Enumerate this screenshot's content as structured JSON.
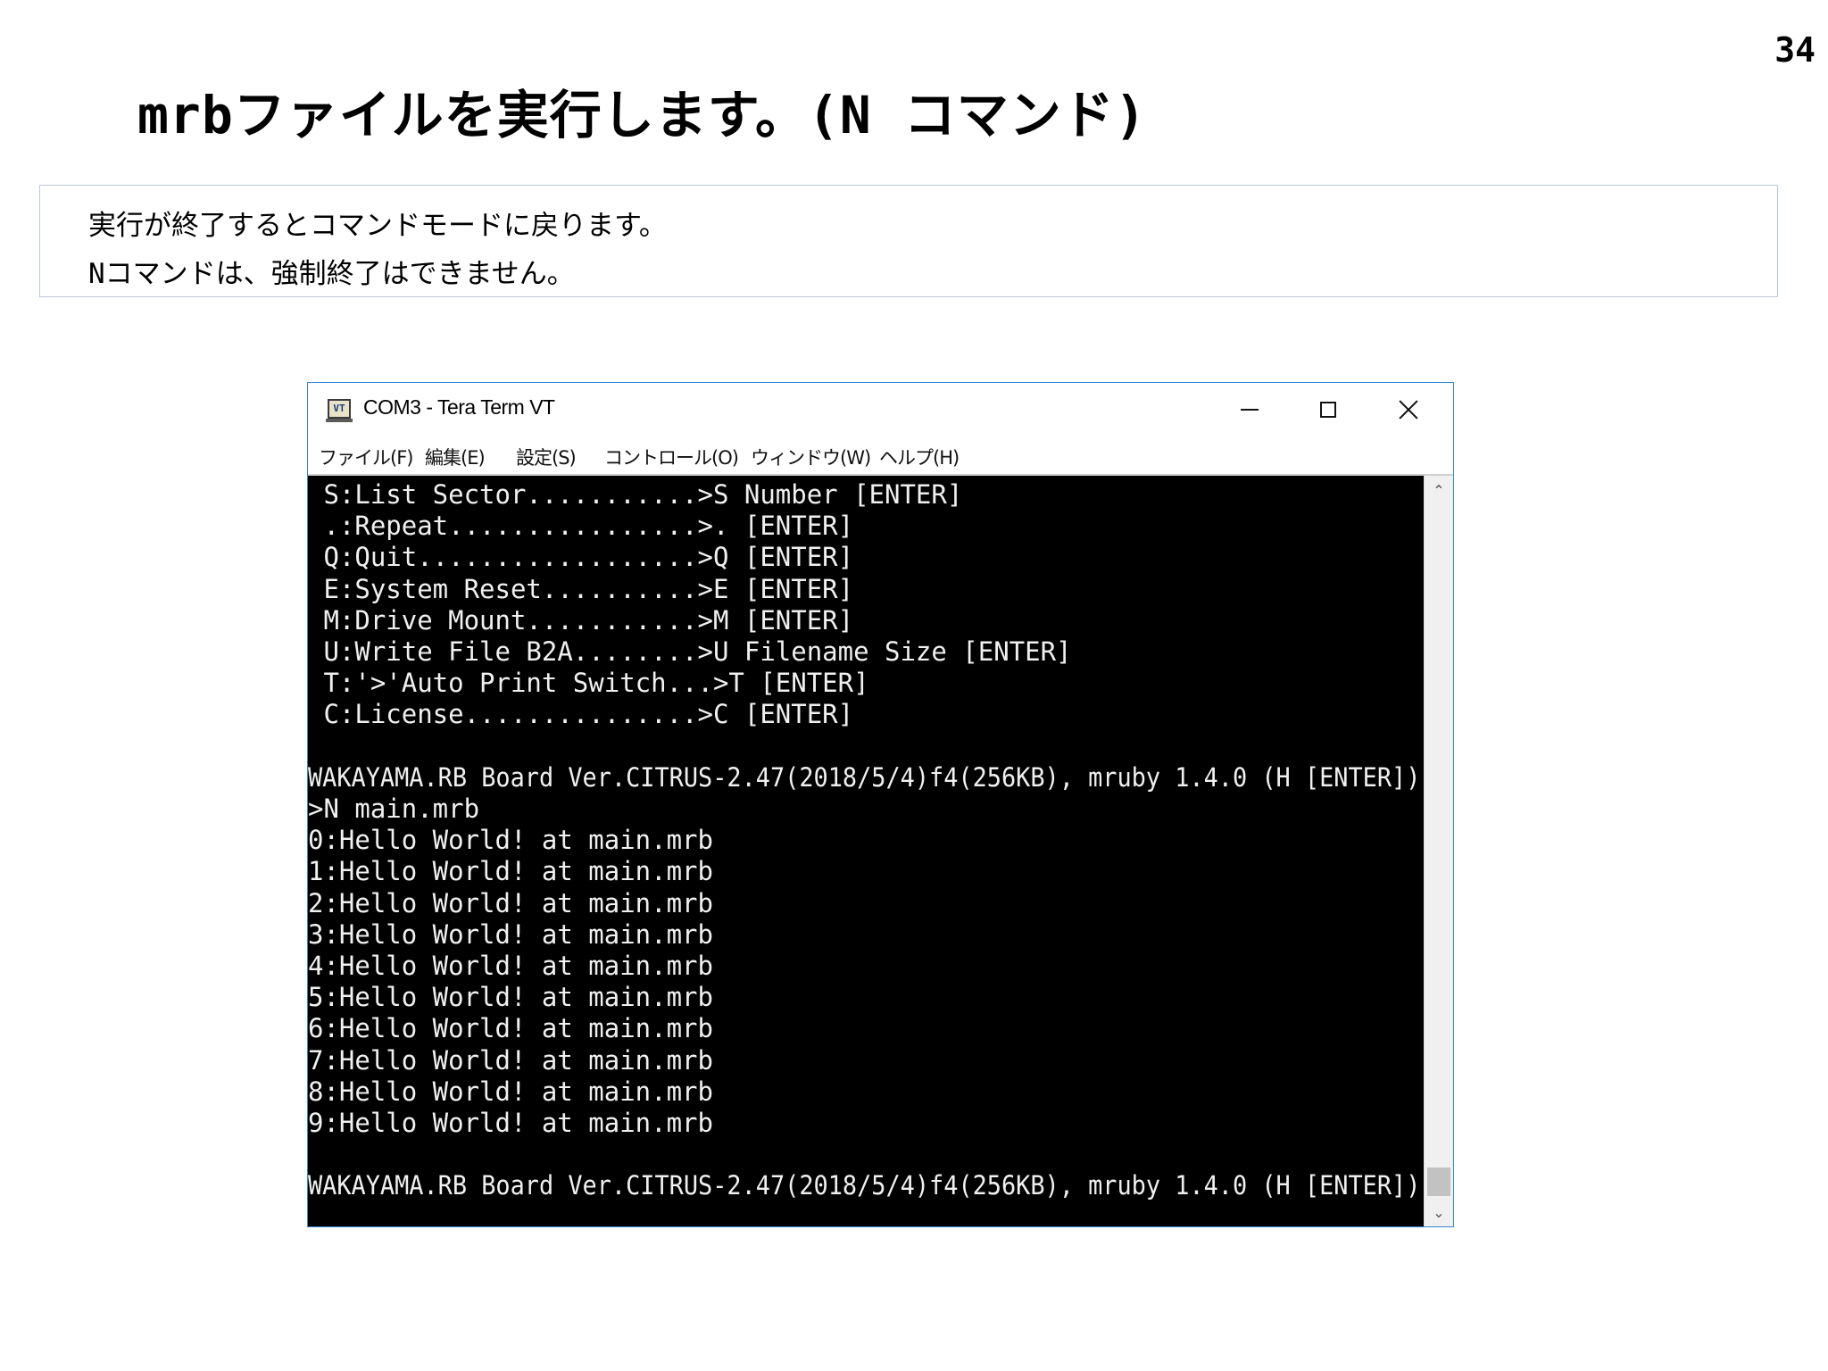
{
  "page": {
    "number": "34",
    "title": "mrbファイルを実行します。(N コマンド)",
    "notes": [
      "実行が終了するとコマンドモードに戻ります。",
      "Nコマンドは、強制終了はできません。"
    ]
  },
  "window": {
    "icon_label": "VT",
    "title": "COM3 - Tera Term VT",
    "menu": [
      "ファイル(F)",
      "編集(E)",
      "設定(S)",
      "コントロール(O)",
      "ウィンドウ(W)",
      "ヘルプ(H)"
    ]
  },
  "terminal": {
    "lines": [
      " S:List Sector...........>S Number [ENTER]",
      " .:Repeat................>. [ENTER]",
      " Q:Quit..................>Q [ENTER]",
      " E:System Reset..........>E [ENTER]",
      " M:Drive Mount...........>M [ENTER]",
      " U:Write File B2A........>U Filename Size [ENTER]",
      " T:'>'Auto Print Switch...>T [ENTER]",
      " C:License...............>C [ENTER]",
      "",
      "WAKAYAMA.RB Board Ver.CITRUS-2.47(2018/5/4)f4(256KB), mruby 1.4.0 (H [ENTER])",
      ">N main.mrb",
      "0:Hello World! at main.mrb",
      "1:Hello World! at main.mrb",
      "2:Hello World! at main.mrb",
      "3:Hello World! at main.mrb",
      "4:Hello World! at main.mrb",
      "5:Hello World! at main.mrb",
      "6:Hello World! at main.mrb",
      "7:Hello World! at main.mrb",
      "8:Hello World! at main.mrb",
      "9:Hello World! at main.mrb",
      "",
      "WAKAYAMA.RB Board Ver.CITRUS-2.47(2018/5/4)f4(256KB), mruby 1.4.0 (H [ENTER])"
    ],
    "prompt": ">"
  }
}
